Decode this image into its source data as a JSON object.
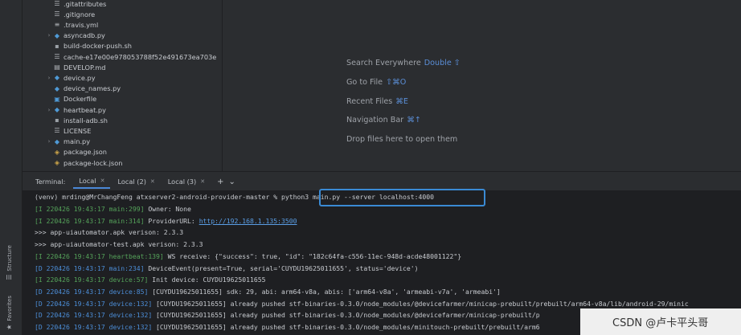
{
  "toolstrip": {
    "structure_label": "Structure",
    "favorites_label": "Favorites"
  },
  "tree": {
    "items": [
      {
        "label": ".gitattributes",
        "icon": "file-icon",
        "chevron": ""
      },
      {
        "label": ".gitignore",
        "icon": "file-icon",
        "chevron": ""
      },
      {
        "label": ".travis.yml",
        "icon": "yaml-icon",
        "chevron": ""
      },
      {
        "label": "asyncadb.py",
        "icon": "python-folder-icon",
        "chevron": "›"
      },
      {
        "label": "build-docker-push.sh",
        "icon": "shell-icon",
        "chevron": ""
      },
      {
        "label": "cache-e17e00e978053788f52e491673ea703e",
        "icon": "file-icon",
        "chevron": ""
      },
      {
        "label": "DEVELOP.md",
        "icon": "markdown-icon",
        "chevron": ""
      },
      {
        "label": "device.py",
        "icon": "python-folder-icon",
        "chevron": "›"
      },
      {
        "label": "device_names.py",
        "icon": "python-file-icon",
        "chevron": ""
      },
      {
        "label": "Dockerfile",
        "icon": "docker-icon",
        "chevron": ""
      },
      {
        "label": "heartbeat.py",
        "icon": "python-folder-icon",
        "chevron": "›"
      },
      {
        "label": "install-adb.sh",
        "icon": "shell-icon",
        "chevron": ""
      },
      {
        "label": "LICENSE",
        "icon": "file-icon",
        "chevron": ""
      },
      {
        "label": "main.py",
        "icon": "python-folder-icon",
        "chevron": "›"
      },
      {
        "label": "package.json",
        "icon": "json-icon",
        "chevron": ""
      },
      {
        "label": "package-lock.json",
        "icon": "json-icon",
        "chevron": ""
      }
    ]
  },
  "editor": {
    "hints": [
      {
        "text": "Search Everywhere",
        "key": "Double ⇧"
      },
      {
        "text": "Go to File",
        "key": "⇧⌘O"
      },
      {
        "text": "Recent Files",
        "key": "⌘E"
      },
      {
        "text": "Navigation Bar",
        "key": "⌘↑"
      },
      {
        "text": "Drop files here to open them",
        "key": ""
      }
    ]
  },
  "terminal": {
    "label": "Terminal:",
    "tabs": [
      "Local",
      "Local (2)",
      "Local (3)"
    ],
    "add_label": "+",
    "menu_label": "⌄",
    "prompt": "(venv) mrding@MrChangFeng atxserver2-android-provider-master % ",
    "command": "python3 main.py --server localhost:4000",
    "lines": [
      {
        "segments": [
          {
            "t": "[I 220426 19:43:17 main:299]",
            "c": "green"
          },
          {
            "t": " Owner: None",
            "c": "white"
          }
        ]
      },
      {
        "segments": [
          {
            "t": "[I 220426 19:43:17 main:314]",
            "c": "green"
          },
          {
            "t": " ProviderURL: ",
            "c": "white"
          },
          {
            "t": "http://192.168.1.135:3500",
            "c": "link"
          }
        ]
      },
      {
        "segments": [
          {
            "t": ">>> app-uiautomator.apk verison: 2.3.3",
            "c": "white"
          }
        ]
      },
      {
        "segments": [
          {
            "t": ">>> app-uiautomator-test.apk verison: 2.3.3",
            "c": "white"
          }
        ]
      },
      {
        "segments": [
          {
            "t": "[I 220426 19:43:17 heartbeat:139]",
            "c": "green"
          },
          {
            "t": " WS receive: {\"success\": true, \"id\": \"182c64fa-c556-11ec-948d-acde48001122\"}",
            "c": "white"
          }
        ]
      },
      {
        "segments": [
          {
            "t": "[D 220426 19:43:17 main:234]",
            "c": "blue"
          },
          {
            "t": " DeviceEvent(present=True, serial='CUYDU19625011655', status='device')",
            "c": "white"
          }
        ]
      },
      {
        "segments": [
          {
            "t": "[I 220426 19:43:17 device:57]",
            "c": "green"
          },
          {
            "t": " Init device: CUYDU19625011655",
            "c": "white"
          }
        ]
      },
      {
        "segments": [
          {
            "t": "[D 220426 19:43:17 device:85]",
            "c": "blue"
          },
          {
            "t": " [CUYDU19625011655] sdk: 29, abi: arm64-v8a, abis: ['arm64-v8a', 'armeabi-v7a', 'armeabi']",
            "c": "white"
          }
        ]
      },
      {
        "segments": [
          {
            "t": "[D 220426 19:43:17 device:132]",
            "c": "blue"
          },
          {
            "t": " [CUYDU19625011655] already pushed stf-binaries-0.3.0/node_modules/@devicefarmer/minicap-prebuilt/prebuilt/arm64-v8a/lib/android-29/minic",
            "c": "white"
          }
        ]
      },
      {
        "segments": [
          {
            "t": "[D 220426 19:43:17 device:132]",
            "c": "blue"
          },
          {
            "t": " [CUYDU19625011655] already pushed stf-binaries-0.3.0/node_modules/@devicefarmer/minicap-prebuilt/p",
            "c": "white"
          }
        ]
      },
      {
        "segments": [
          {
            "t": "[D 220426 19:43:17 device:132]",
            "c": "blue"
          },
          {
            "t": " [CUYDU19625011655] already pushed stf-binaries-0.3.0/node_modules/minitouch-prebuilt/prebuilt/arm6",
            "c": "white"
          }
        ]
      }
    ]
  },
  "watermark": "CSDN @卢卡平头哥"
}
